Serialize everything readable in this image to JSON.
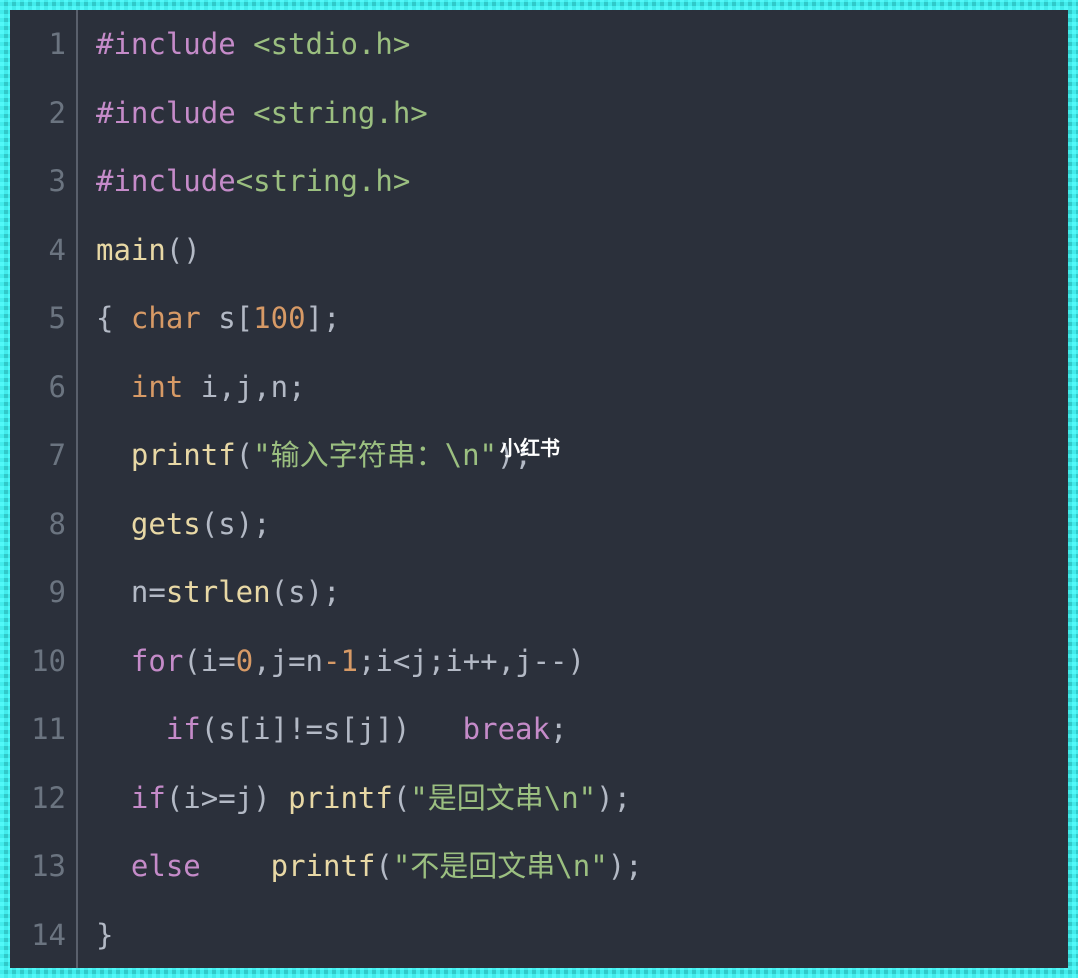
{
  "watermark": "小红书",
  "lines": [
    {
      "n": "1",
      "tokens": [
        {
          "t": "#include ",
          "c": "pp"
        },
        {
          "t": "<stdio.h>",
          "c": "inc"
        }
      ]
    },
    {
      "n": "2",
      "tokens": [
        {
          "t": "#include ",
          "c": "pp"
        },
        {
          "t": "<string.h>",
          "c": "inc"
        }
      ]
    },
    {
      "n": "3",
      "tokens": [
        {
          "t": "#include",
          "c": "pp"
        },
        {
          "t": "<string.h>",
          "c": "inc"
        }
      ]
    },
    {
      "n": "4",
      "tokens": [
        {
          "t": "main",
          "c": "fn"
        },
        {
          "t": "()",
          "c": "pl"
        }
      ]
    },
    {
      "n": "5",
      "tokens": [
        {
          "t": "{ ",
          "c": "pl"
        },
        {
          "t": "char",
          "c": "ty"
        },
        {
          "t": " s[",
          "c": "pl"
        },
        {
          "t": "100",
          "c": "num"
        },
        {
          "t": "];",
          "c": "pl"
        }
      ]
    },
    {
      "n": "6",
      "tokens": [
        {
          "t": "  ",
          "c": "pl"
        },
        {
          "t": "int",
          "c": "ty"
        },
        {
          "t": " i,j,n;",
          "c": "pl"
        }
      ]
    },
    {
      "n": "7",
      "tokens": [
        {
          "t": "  ",
          "c": "pl"
        },
        {
          "t": "printf",
          "c": "fn"
        },
        {
          "t": "(",
          "c": "pl"
        },
        {
          "t": "\"输入字符串：\\n\"",
          "c": "str"
        },
        {
          "t": ");",
          "c": "pl"
        }
      ]
    },
    {
      "n": "8",
      "tokens": [
        {
          "t": "  ",
          "c": "pl"
        },
        {
          "t": "gets",
          "c": "fn"
        },
        {
          "t": "(s);",
          "c": "pl"
        }
      ]
    },
    {
      "n": "9",
      "tokens": [
        {
          "t": "  n=",
          "c": "pl"
        },
        {
          "t": "strlen",
          "c": "fn"
        },
        {
          "t": "(s);",
          "c": "pl"
        }
      ]
    },
    {
      "n": "10",
      "tokens": [
        {
          "t": "  ",
          "c": "pl"
        },
        {
          "t": "for",
          "c": "kw"
        },
        {
          "t": "(i=",
          "c": "pl"
        },
        {
          "t": "0",
          "c": "num"
        },
        {
          "t": ",j=n",
          "c": "pl"
        },
        {
          "t": "-1",
          "c": "num"
        },
        {
          "t": ";i<j;i++,j--)",
          "c": "pl"
        }
      ]
    },
    {
      "n": "11",
      "tokens": [
        {
          "t": "    ",
          "c": "pl"
        },
        {
          "t": "if",
          "c": "kw"
        },
        {
          "t": "(s[i]!=s[j])   ",
          "c": "pl"
        },
        {
          "t": "break",
          "c": "kw"
        },
        {
          "t": ";",
          "c": "pl"
        }
      ]
    },
    {
      "n": "12",
      "tokens": [
        {
          "t": "  ",
          "c": "pl"
        },
        {
          "t": "if",
          "c": "kw"
        },
        {
          "t": "(i>=j) ",
          "c": "pl"
        },
        {
          "t": "printf",
          "c": "fn"
        },
        {
          "t": "(",
          "c": "pl"
        },
        {
          "t": "\"是回文串\\n\"",
          "c": "str"
        },
        {
          "t": ");",
          "c": "pl"
        }
      ]
    },
    {
      "n": "13",
      "tokens": [
        {
          "t": "  ",
          "c": "pl"
        },
        {
          "t": "else",
          "c": "kw"
        },
        {
          "t": "    ",
          "c": "pl"
        },
        {
          "t": "printf",
          "c": "fn"
        },
        {
          "t": "(",
          "c": "pl"
        },
        {
          "t": "\"不是回文串\\n\"",
          "c": "str"
        },
        {
          "t": ");",
          "c": "pl"
        }
      ]
    },
    {
      "n": "14",
      "tokens": [
        {
          "t": "}",
          "c": "pl"
        }
      ]
    }
  ]
}
